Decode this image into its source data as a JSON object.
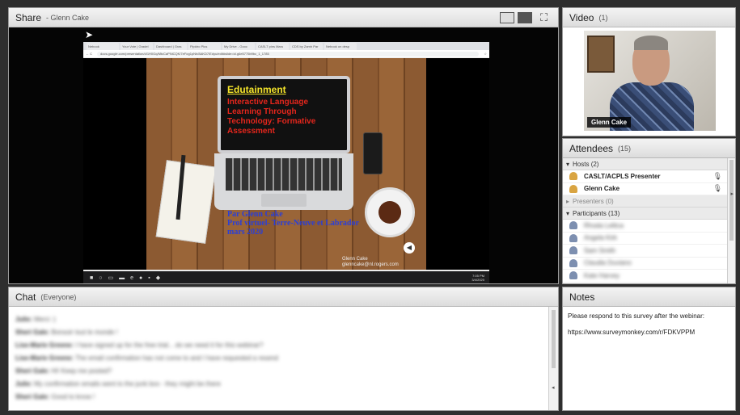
{
  "share": {
    "title": "Share",
    "presenter": "- Glenn Cake",
    "browser": {
      "tabs": [
        "Nebook",
        "Your Vote | Gradel",
        "Dashboard | Gras",
        "Pipidro Plus",
        "My Drive - Gooc",
        "CASLT pins Maru",
        "CDS by Zamh Par",
        "Nebook on desp"
      ],
      "url": "docs.google.com/presentation/d/1H0Gq/MtcCaPNiCQK/7eFog1pNh/8AKD7/Edyu/edit#slide=id.g6e5775b9bc_1_1785"
    },
    "slide": {
      "title": "Edutainment",
      "subtitle_lines": [
        "Interactive Language",
        "Learning Through",
        "Technology: Formative",
        "Assessment"
      ],
      "author_lines": [
        "Par Glenn Cake",
        "Prof virtuel- Terre-Neuve et Labrador",
        "mars 2020"
      ],
      "contact_lines": [
        "Glenn Cake",
        "glenncake@nl.rogers.com"
      ]
    },
    "taskbar": {
      "clock_time": "7:05 PM",
      "clock_date": "3/4/2020"
    }
  },
  "video": {
    "title": "Video",
    "count": "(1)",
    "name_label": "Glenn Cake"
  },
  "attendees": {
    "title": "Attendees",
    "count": "(15)",
    "hosts_label": "Hosts (2)",
    "hosts": [
      "CASLT/ACPLS Presenter",
      "Glenn Cake"
    ],
    "presenters_label": "Presenters (0)",
    "participants_label": "Participants (13)",
    "participants": [
      "Rhoda Lelitca",
      "Angela Kirk",
      "Sam Smith",
      "Claudia Duviano",
      "Kate Harvey"
    ]
  },
  "chat": {
    "title": "Chat",
    "scope": "(Everyone)",
    "messages": [
      {
        "sender": "Julie:",
        "text": "Merci :)"
      },
      {
        "sender": "Sheri Gale:",
        "text": "Bonsoir tout le monde !"
      },
      {
        "sender": "Lise-Marie Greene:",
        "text": "I have signed up for the free trial... do we need it for this webinar?"
      },
      {
        "sender": "Lise-Marie Greene:",
        "text": "The email confirmation has not come to and I have requested a resend"
      },
      {
        "sender": "Sheri Gale:",
        "text": "Hi! Keep me posted?"
      },
      {
        "sender": "Julie:",
        "text": "My confirmation emails went to the junk box - they might be there"
      },
      {
        "sender": "Sheri Gale:",
        "text": "Good to know !"
      }
    ]
  },
  "notes": {
    "title": "Notes",
    "line1": "Please respond to this survey after the webinar:",
    "line2": "https://www.surveymonkey.com/r/FDKVPPM"
  }
}
